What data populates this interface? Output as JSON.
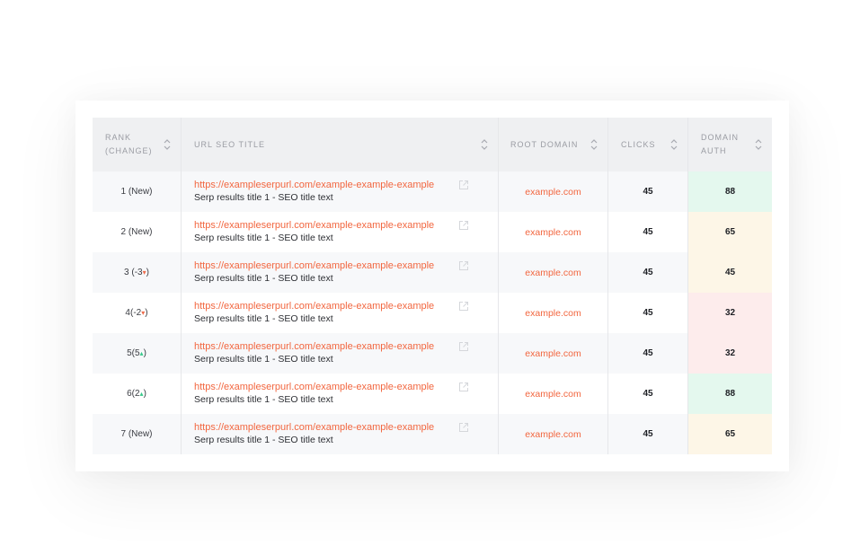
{
  "columns": {
    "rank_line1": "RANK",
    "rank_line2": "(CHANGE)",
    "url": "URL SEO TITLE",
    "root": "ROOT DOMAIN",
    "clicks": "CLICKS",
    "auth_line1": "DOMAIN",
    "auth_line2": "AUTH"
  },
  "colors": {
    "good": "#e4f8ee",
    "mid": "#fdf6e7",
    "bad": "#fdecec",
    "accent": "#f2663f"
  },
  "rows": [
    {
      "rank": "1 (New)",
      "arrow": "",
      "rank_close": "",
      "url": "https://exampleserpurl.com/example-example-example",
      "title": "Serp results title 1 - SEO title text",
      "root": "example.com",
      "clicks": "45",
      "auth": "88",
      "auth_level": "good"
    },
    {
      "rank": "2 (New)",
      "arrow": "",
      "rank_close": "",
      "url": "https://exampleserpurl.com/example-example-example",
      "title": "Serp results title 1 - SEO title text",
      "root": "example.com",
      "clicks": "45",
      "auth": "65",
      "auth_level": "mid"
    },
    {
      "rank": "3 (-3",
      "arrow": "down",
      "rank_close": ")",
      "url": "https://exampleserpurl.com/example-example-example",
      "title": "Serp results title 1 - SEO title text",
      "root": "example.com",
      "clicks": "45",
      "auth": "45",
      "auth_level": "mid"
    },
    {
      "rank": "4(-2",
      "arrow": "down",
      "rank_close": ")",
      "url": "https://exampleserpurl.com/example-example-example",
      "title": "Serp results title 1 - SEO title text",
      "root": "example.com",
      "clicks": "45",
      "auth": "32",
      "auth_level": "bad"
    },
    {
      "rank": "5(5",
      "arrow": "up",
      "rank_close": ")",
      "url": "https://exampleserpurl.com/example-example-example",
      "title": "Serp results title 1 - SEO title text",
      "root": "example.com",
      "clicks": "45",
      "auth": "32",
      "auth_level": "bad"
    },
    {
      "rank": "6(2",
      "arrow": "up",
      "rank_close": ")",
      "url": "https://exampleserpurl.com/example-example-example",
      "title": "Serp results title 1 - SEO title text",
      "root": "example.com",
      "clicks": "45",
      "auth": "88",
      "auth_level": "good"
    },
    {
      "rank": "7 (New)",
      "arrow": "",
      "rank_close": "",
      "url": "https://exampleserpurl.com/example-example-example",
      "title": "Serp results title 1 - SEO title text",
      "root": "example.com",
      "clicks": "45",
      "auth": "65",
      "auth_level": "mid"
    }
  ]
}
